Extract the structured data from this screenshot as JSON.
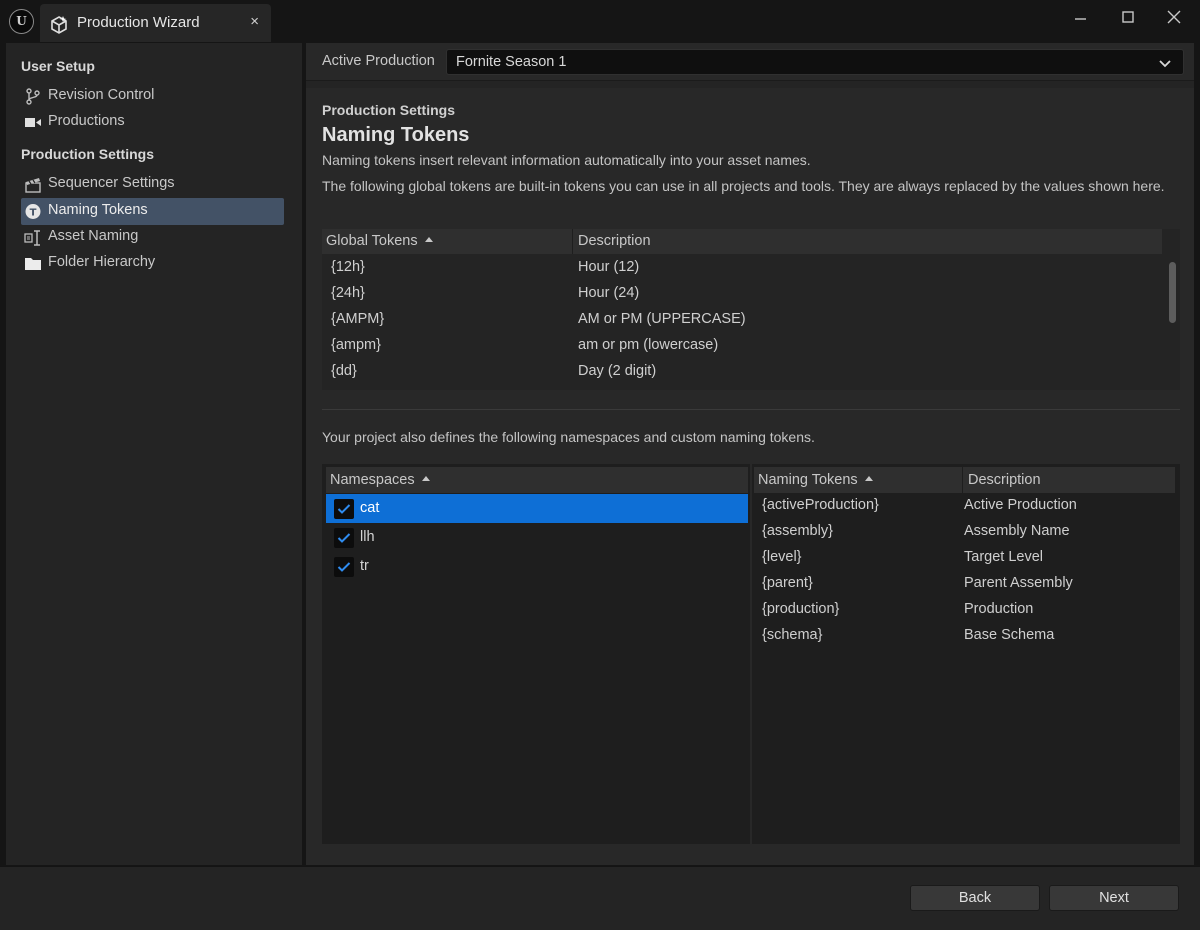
{
  "window": {
    "tab_title": "Production Wizard",
    "close_glyph": "×",
    "icons": [
      "unreal-logo-icon",
      "production-wizard-icon",
      "close-icon",
      "minimize-icon",
      "maximize-icon",
      "window-close-icon"
    ]
  },
  "sidebar": {
    "sections": [
      {
        "header": "User Setup",
        "items": [
          {
            "label": "Revision Control",
            "icon": "branch-icon"
          },
          {
            "label": "Productions",
            "icon": "video-camera-icon"
          }
        ]
      },
      {
        "header": "Production Settings",
        "items": [
          {
            "label": "Sequencer Settings",
            "icon": "clapperboard-icon"
          },
          {
            "label": "Naming Tokens",
            "icon": "token-icon",
            "selected": true
          },
          {
            "label": "Asset Naming",
            "icon": "text-cursor-icon"
          },
          {
            "label": "Folder Hierarchy",
            "icon": "folder-icon"
          }
        ]
      }
    ]
  },
  "active_production": {
    "label": "Active Production",
    "value": "Fornite Season 1"
  },
  "page": {
    "section_label": "Production Settings",
    "title": "Naming Tokens",
    "description_1": "Naming tokens insert relevant information automatically into your asset names.",
    "description_2": "The following global tokens are built-in tokens you can use in all projects and tools. They are always replaced by the values shown here.",
    "description_3": "Your project also defines the following namespaces and custom naming tokens."
  },
  "global_tokens": {
    "columns": [
      "Global Tokens",
      "Description"
    ],
    "rows": [
      {
        "token": "{12h}",
        "description": "Hour (12)"
      },
      {
        "token": "{24h}",
        "description": "Hour (24)"
      },
      {
        "token": "{AMPM}",
        "description": "AM or PM (UPPERCASE)"
      },
      {
        "token": "{ampm}",
        "description": "am or pm (lowercase)"
      },
      {
        "token": "{dd}",
        "description": "Day (2 digit)"
      }
    ]
  },
  "namespaces": {
    "column": "Namespaces",
    "rows": [
      {
        "label": "cat",
        "checked": true,
        "selected": true
      },
      {
        "label": "llh",
        "checked": true
      },
      {
        "label": "tr",
        "checked": true
      }
    ]
  },
  "naming_tokens": {
    "columns": [
      "Naming Tokens",
      "Description"
    ],
    "rows": [
      {
        "token": "{activeProduction}",
        "description": "Active Production"
      },
      {
        "token": "{assembly}",
        "description": "Assembly Name"
      },
      {
        "token": "{level}",
        "description": "Target Level"
      },
      {
        "token": "{parent}",
        "description": "Parent Assembly"
      },
      {
        "token": "{production}",
        "description": "Production"
      },
      {
        "token": "{schema}",
        "description": "Base Schema"
      }
    ]
  },
  "footer": {
    "back_label": "Back",
    "next_label": "Next"
  },
  "colors": {
    "selection_blue": "#0e6fd6",
    "sidebar_selected": "#435266",
    "background": "#151515",
    "panel": "#242424"
  }
}
